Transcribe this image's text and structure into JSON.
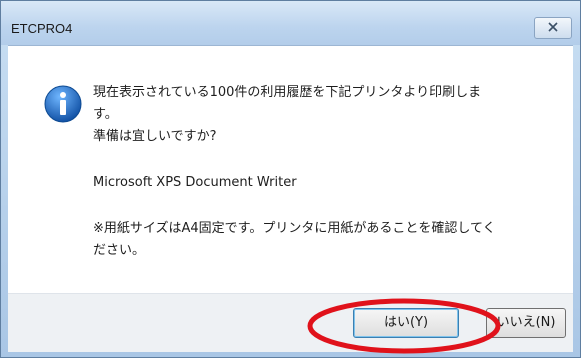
{
  "window": {
    "title": "ETCPRO4",
    "close_label": "⌦"
  },
  "message": {
    "line1": "現在表示されている100件の利用履歴を下記プリンタより印刷しま",
    "line2": "す。",
    "line3": "準備は宜しいですか?",
    "printer_name": "Microsoft XPS Document Writer",
    "note_line1": "※用紙サイズはA4固定です。プリンタに用紙があることを確認してく",
    "note_line2": "ださい。"
  },
  "buttons": {
    "yes_label": "はい(Y)",
    "no_label": "いいえ(N)"
  },
  "icons": {
    "message_icon": "info-icon",
    "annotation": "red-ellipse-highlight"
  },
  "colors": {
    "annotation": "#e0121b",
    "info_icon": "#1f6fc1"
  }
}
